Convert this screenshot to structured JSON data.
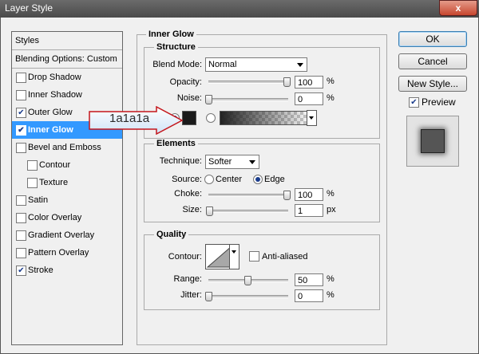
{
  "window": {
    "title": "Layer Style",
    "close": "x"
  },
  "styles_list": {
    "header": "Styles",
    "blending": "Blending Options: Custom",
    "items": [
      {
        "label": "Drop Shadow",
        "checked": false,
        "indent": false
      },
      {
        "label": "Inner Shadow",
        "checked": false,
        "indent": false
      },
      {
        "label": "Outer Glow",
        "checked": true,
        "indent": false
      },
      {
        "label": "Inner Glow",
        "checked": true,
        "indent": false,
        "selected": true
      },
      {
        "label": "Bevel and Emboss",
        "checked": false,
        "indent": false
      },
      {
        "label": "Contour",
        "checked": false,
        "indent": true
      },
      {
        "label": "Texture",
        "checked": false,
        "indent": true
      },
      {
        "label": "Satin",
        "checked": false,
        "indent": false
      },
      {
        "label": "Color Overlay",
        "checked": false,
        "indent": false
      },
      {
        "label": "Gradient Overlay",
        "checked": false,
        "indent": false
      },
      {
        "label": "Pattern Overlay",
        "checked": false,
        "indent": false
      },
      {
        "label": "Stroke",
        "checked": true,
        "indent": false
      }
    ]
  },
  "inner_glow": {
    "title": "Inner Glow",
    "structure": {
      "title": "Structure",
      "blend_mode_label": "Blend Mode:",
      "blend_mode": "Normal",
      "opacity_label": "Opacity:",
      "opacity": "100",
      "noise_label": "Noise:",
      "noise": "0",
      "percent": "%"
    },
    "elements": {
      "title": "Elements",
      "technique_label": "Technique:",
      "technique": "Softer",
      "source_label": "Source:",
      "source_center": "Center",
      "source_edge": "Edge",
      "choke_label": "Choke:",
      "choke": "100",
      "size_label": "Size:",
      "size": "1",
      "px": "px",
      "percent": "%"
    },
    "quality": {
      "title": "Quality",
      "contour_label": "Contour:",
      "anti_aliased": "Anti-aliased",
      "range_label": "Range:",
      "range": "50",
      "jitter_label": "Jitter:",
      "jitter": "0",
      "percent": "%"
    }
  },
  "buttons": {
    "ok": "OK",
    "cancel": "Cancel",
    "new_style": "New Style...",
    "preview": "Preview"
  },
  "annotation": {
    "text": "1a1a1a"
  },
  "colors": {
    "glow": "#1a1a1a",
    "selected": "#3399ff",
    "arrow": "#c4161c"
  }
}
